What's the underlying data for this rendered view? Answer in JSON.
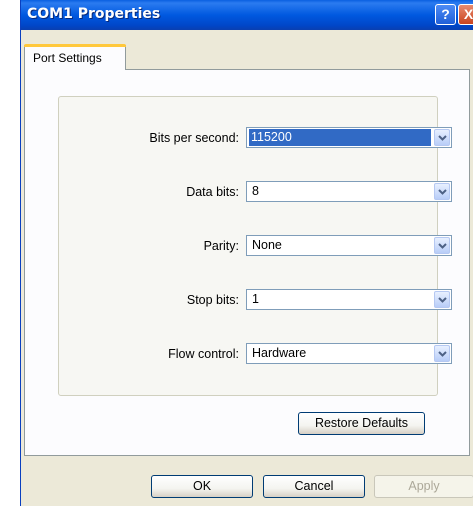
{
  "window": {
    "title": "COM1 Properties"
  },
  "titlebar": {
    "help_label": "?",
    "close_label": "X"
  },
  "tabs": [
    {
      "label": "Port Settings"
    }
  ],
  "port_settings": {
    "fields": [
      {
        "label": "Bits per second:",
        "value": "115200"
      },
      {
        "label": "Data bits:",
        "value": "8"
      },
      {
        "label": "Parity:",
        "value": "None"
      },
      {
        "label": "Stop bits:",
        "value": "1"
      },
      {
        "label": "Flow control:",
        "value": "Hardware"
      }
    ],
    "restore_label": "Restore Defaults"
  },
  "footer": {
    "ok_label": "OK",
    "cancel_label": "Cancel",
    "apply_label": "Apply"
  },
  "colors": {
    "selection": "#316ac5",
    "titlebar": "#0054e3",
    "tab_accent": "#ffc83c"
  }
}
